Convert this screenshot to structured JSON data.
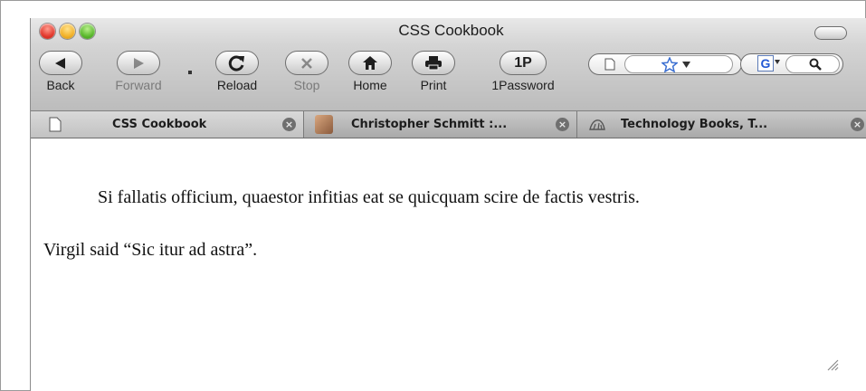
{
  "window": {
    "title": "CSS Cookbook"
  },
  "toolbar": {
    "back": "Back",
    "forward": "Forward",
    "reload": "Reload",
    "stop": "Stop",
    "home": "Home",
    "print": "Print",
    "onepassword": "1Password",
    "onepassword_glyph": "1P"
  },
  "search": {
    "engine_letter": "G"
  },
  "tabs": [
    {
      "label": "CSS Cookbook",
      "active": true,
      "icon": "page-icon"
    },
    {
      "label": "Christopher Schmitt :...",
      "active": false,
      "icon": "portrait-favicon-icon"
    },
    {
      "label": "Technology Books, T...",
      "active": false,
      "icon": "oreilly-favicon-icon"
    }
  ],
  "content": {
    "paragraph1": "Si fallatis officium, quaestor infitias eat se quicquam scire de factis vestris.",
    "paragraph2": "Virgil said “Sic itur ad astra”."
  }
}
